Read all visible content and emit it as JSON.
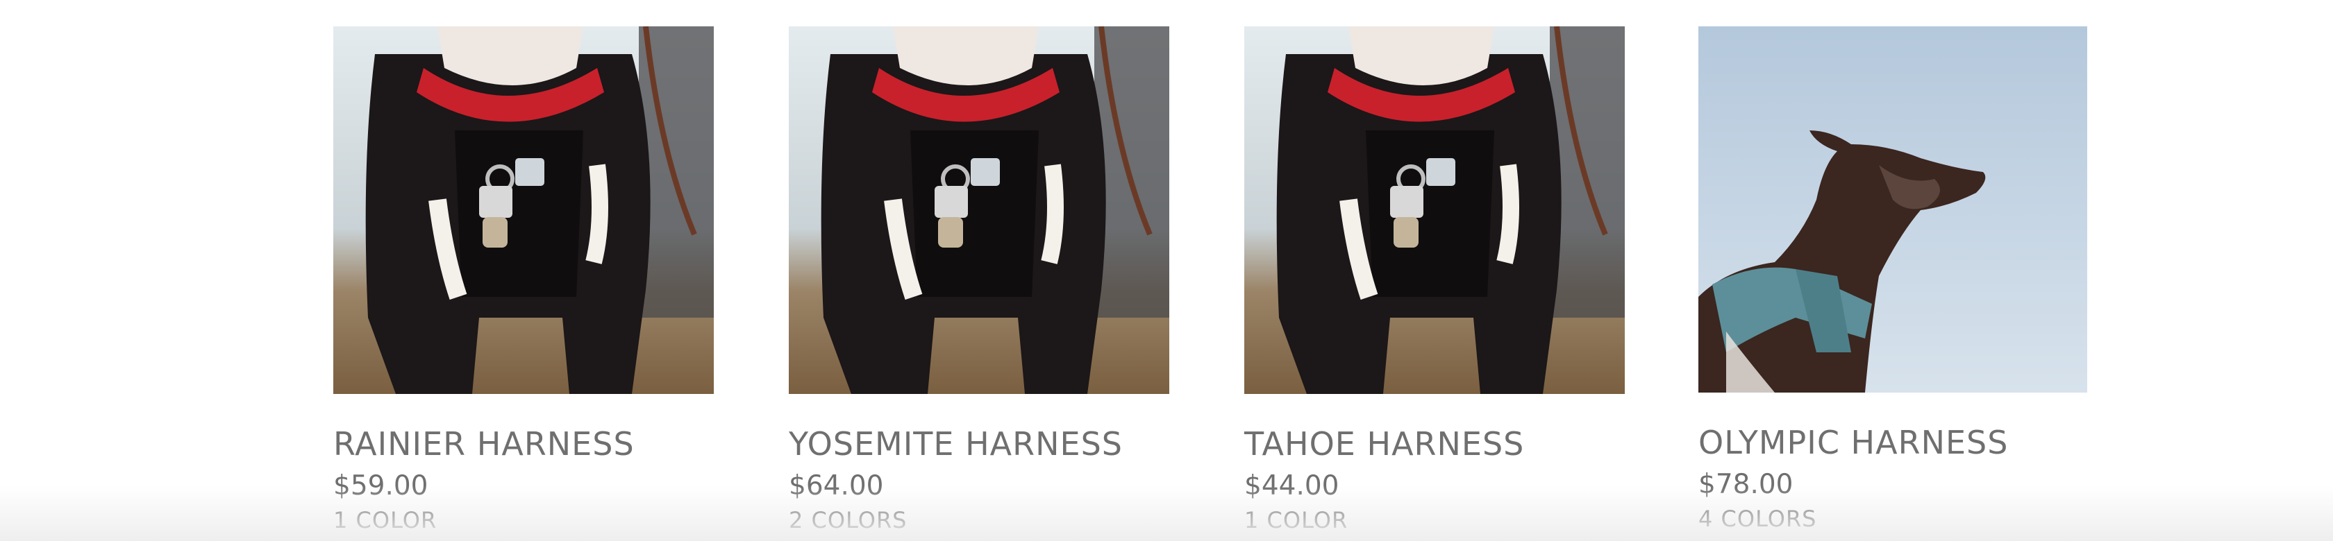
{
  "products": [
    {
      "name": "RAINIER HARNESS",
      "price": "$59.00",
      "colors": "1 COLOR",
      "image": "black-white-dog-red-collar-photo"
    },
    {
      "name": "YOSEMITE HARNESS",
      "price": "$64.00",
      "colors": "2 COLORS",
      "image": "black-white-dog-red-collar-photo"
    },
    {
      "name": "TAHOE HARNESS",
      "price": "$44.00",
      "colors": "1 COLOR",
      "image": "black-white-dog-red-collar-photo"
    },
    {
      "name": "OLYMPIC HARNESS",
      "price": "$78.00",
      "colors": "4 COLORS",
      "image": "brown-dog-blue-harness-sky-photo"
    }
  ],
  "theme": {
    "text_color": "#6f6f6f",
    "background": "#ffffff"
  }
}
